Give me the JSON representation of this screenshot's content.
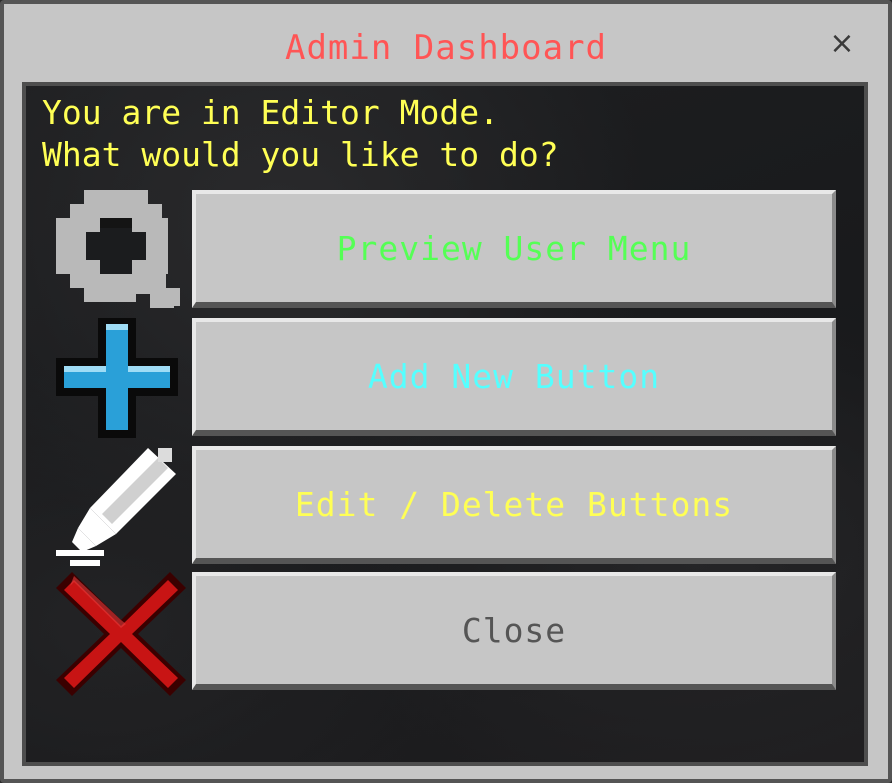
{
  "window": {
    "title": "Admin Dashboard",
    "close_glyph": "×"
  },
  "prompt": {
    "line1": "You are in Editor Mode.",
    "line2": "What would you like to do?"
  },
  "buttons": [
    {
      "label": "Preview User Menu",
      "color": "#55ff55",
      "icon": "magnifier-icon"
    },
    {
      "label": "Add New Button",
      "color": "#55ffff",
      "icon": "plus-icon"
    },
    {
      "label": "Edit / Delete Buttons",
      "color": "#ffff55",
      "icon": "pencil-icon"
    },
    {
      "label": "Close",
      "color": "#555555",
      "icon": "red-x-icon"
    }
  ],
  "colors": {
    "title": "#ff5555",
    "prompt": "#ffff55",
    "panel_bg": "#1b1c1e",
    "window_bg": "#c6c6c6"
  }
}
